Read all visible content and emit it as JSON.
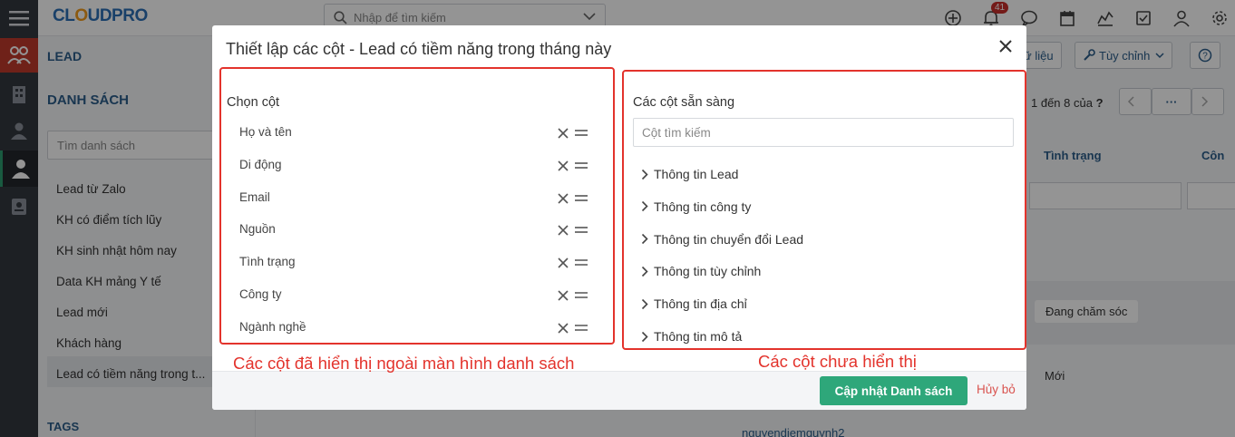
{
  "header": {
    "logo_text_a": "CL",
    "logo_text_b": "O",
    "logo_text_c": "UDPRO",
    "search_placeholder": "Nhập để tìm kiếm",
    "notification_count": "41"
  },
  "sidebar": {
    "module": "LEAD",
    "section": "DANH SÁCH",
    "search_placeholder": "Tìm danh sách",
    "items": [
      {
        "label": "Lead từ Zalo"
      },
      {
        "label": "KH có điểm tích lũy"
      },
      {
        "label": "KH sinh nhật hôm nay"
      },
      {
        "label": "Data KH mảng Y tế"
      },
      {
        "label": "Lead mới"
      },
      {
        "label": "Khách hàng"
      },
      {
        "label": "Lead có tiềm năng trong t..."
      }
    ],
    "tags_label": "TAGS"
  },
  "background": {
    "btn_data": "ữ liệu",
    "btn_customize": "Tùy chỉnh",
    "pagination_text": "1 đến 8 của",
    "pagination_q": "?",
    "pagination_more": "···",
    "col_status": "Tình trạng",
    "col_company": "Côn",
    "tag_caring": "Đang chăm sóc",
    "tag_new": "Mới",
    "email_partial": "nguyendiemquynh2"
  },
  "modal": {
    "title": "Thiết lập các cột - Lead có tiềm năng trong tháng này",
    "left_heading": "Chọn cột",
    "selected_columns": [
      {
        "label": "Họ và tên"
      },
      {
        "label": "Di động"
      },
      {
        "label": "Email"
      },
      {
        "label": "Nguồn"
      },
      {
        "label": "Tình trạng"
      },
      {
        "label": "Công ty"
      },
      {
        "label": "Ngành nghề"
      }
    ],
    "right_heading": "Các cột sẵn sàng",
    "column_search_placeholder": "Cột tìm kiếm",
    "groups": [
      {
        "label": "Thông tin Lead"
      },
      {
        "label": "Thông tin công ty"
      },
      {
        "label": "Thông tin chuyển đổi Lead"
      },
      {
        "label": "Thông tin tùy chỉnh"
      },
      {
        "label": "Thông tin địa chỉ"
      },
      {
        "label": "Thông tin mô tả"
      }
    ],
    "update_button": "Cập nhật Danh sách",
    "cancel_button": "Hủy bỏ"
  },
  "annotations": {
    "left": "Các cột đã hiển thị ngoài màn hình danh sách",
    "right": "Các cột chưa hiển thị"
  },
  "colors": {
    "annotation_red": "#e3332c",
    "primary_green": "#2ea77a",
    "rail_active": "#c0392b"
  }
}
